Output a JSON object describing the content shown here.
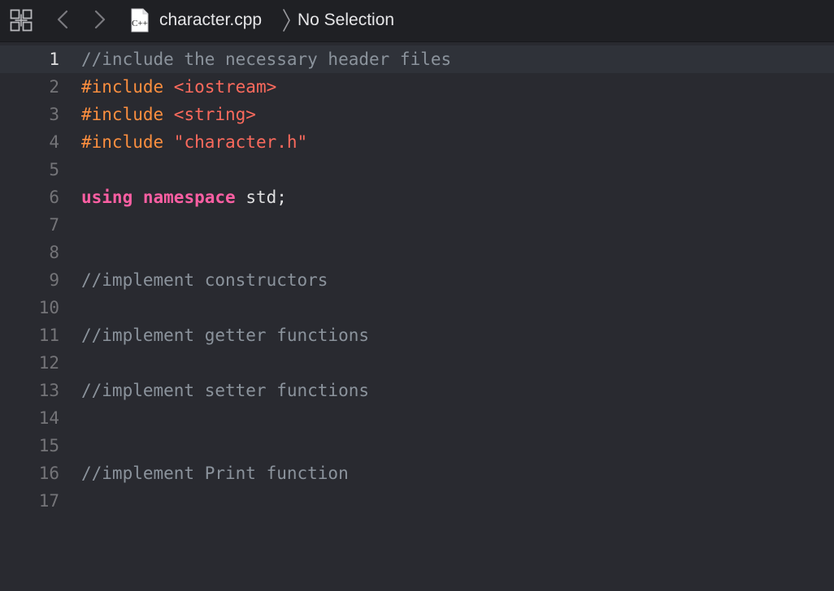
{
  "jumpbar": {
    "filename": "character.cpp",
    "file_badge": "C++",
    "selection": "No Selection",
    "icons": {
      "related_items": "related-items-grid-icon",
      "back": "chevron-left-icon",
      "forward": "chevron-right-icon",
      "file": "cpp-file-icon",
      "separator": "breadcrumb-separator-icon"
    }
  },
  "colors": {
    "background": "#292a30",
    "comment": "#8b939c",
    "preprocessor": "#fd8f3f",
    "string": "#fc6a5d",
    "keyword": "#fc5fa3",
    "plain": "#dfdfe0",
    "line_number": "#747478",
    "current_line": "#2f3239"
  },
  "editor": {
    "current_line": 1,
    "lines": [
      {
        "number": "1",
        "tokens": [
          {
            "type": "comment",
            "text": "//include the necessary header files"
          }
        ]
      },
      {
        "number": "2",
        "tokens": [
          {
            "type": "preproc",
            "text": "#include "
          },
          {
            "type": "string",
            "text": "<iostream>"
          }
        ]
      },
      {
        "number": "3",
        "tokens": [
          {
            "type": "preproc",
            "text": "#include "
          },
          {
            "type": "string",
            "text": "<string>"
          }
        ]
      },
      {
        "number": "4",
        "tokens": [
          {
            "type": "preproc",
            "text": "#include "
          },
          {
            "type": "string",
            "text": "\"character.h\""
          }
        ]
      },
      {
        "number": "5",
        "tokens": []
      },
      {
        "number": "6",
        "tokens": [
          {
            "type": "keyword",
            "text": "using"
          },
          {
            "type": "plain",
            "text": " "
          },
          {
            "type": "keyword",
            "text": "namespace"
          },
          {
            "type": "plain",
            "text": " std;"
          }
        ]
      },
      {
        "number": "7",
        "tokens": []
      },
      {
        "number": "8",
        "tokens": []
      },
      {
        "number": "9",
        "tokens": [
          {
            "type": "comment",
            "text": "//implement constructors"
          }
        ]
      },
      {
        "number": "10",
        "tokens": []
      },
      {
        "number": "11",
        "tokens": [
          {
            "type": "comment",
            "text": "//implement getter functions"
          }
        ]
      },
      {
        "number": "12",
        "tokens": []
      },
      {
        "number": "13",
        "tokens": [
          {
            "type": "comment",
            "text": "//implement setter functions"
          }
        ]
      },
      {
        "number": "14",
        "tokens": []
      },
      {
        "number": "15",
        "tokens": []
      },
      {
        "number": "16",
        "tokens": [
          {
            "type": "comment",
            "text": "//implement Print function"
          }
        ]
      },
      {
        "number": "17",
        "tokens": []
      }
    ]
  }
}
